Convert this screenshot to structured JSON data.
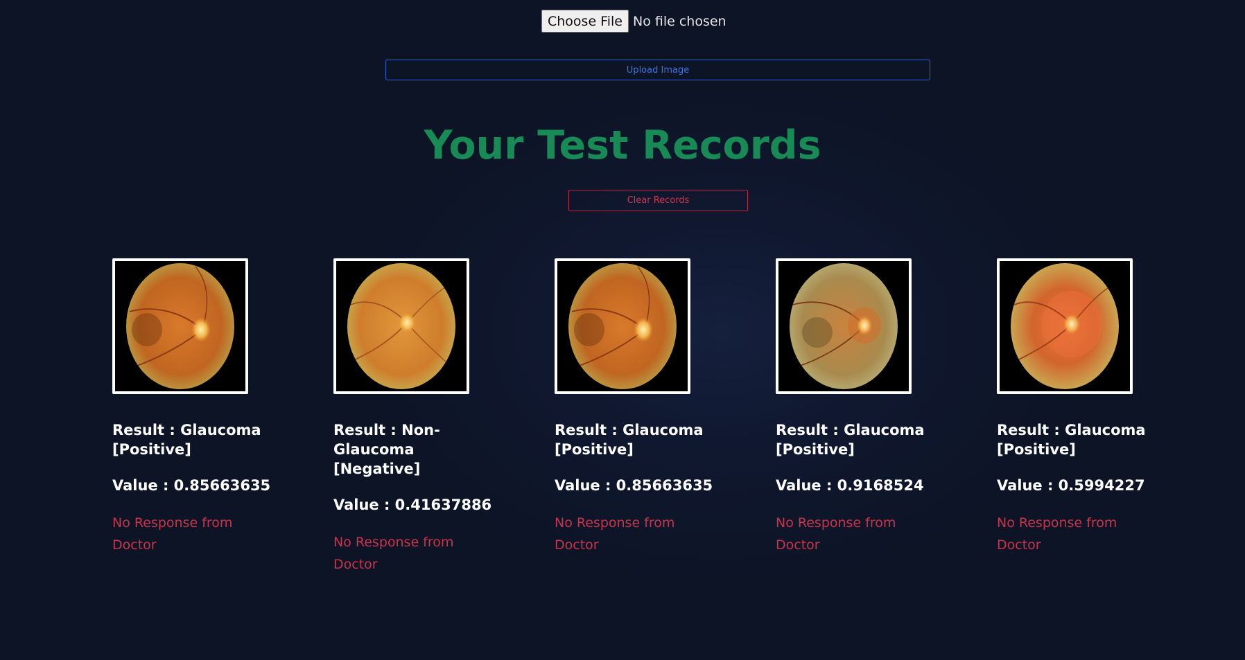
{
  "file_input": {
    "button_label": "Choose File",
    "status_text": "No file chosen"
  },
  "upload_button": {
    "label": "Upload Image"
  },
  "page_title": "Your Test Records",
  "clear_button": {
    "label": "Clear Records"
  },
  "colors": {
    "background": "#0d1426",
    "title_green": "#178a55",
    "upload_blue": "#2e63d6",
    "clear_red": "#c0283d",
    "response_red": "#c8354a"
  },
  "records": [
    {
      "result": "Result : Glaucoma [Positive]",
      "value": "Value : 0.85663635",
      "response": "No Response from Doctor",
      "image_icon": "retina-fundus-image"
    },
    {
      "result": "Result : Non-Glaucoma [Negative]",
      "value": "Value : 0.41637886",
      "response": "No Response from Doctor",
      "image_icon": "retina-fundus-image"
    },
    {
      "result": "Result : Glaucoma [Positive]",
      "value": "Value : 0.85663635",
      "response": "No Response from Doctor",
      "image_icon": "retina-fundus-image"
    },
    {
      "result": "Result : Glaucoma [Positive]",
      "value": "Value : 0.9168524",
      "response": "No Response from Doctor",
      "image_icon": "retina-fundus-image"
    },
    {
      "result": "Result : Glaucoma [Positive]",
      "value": "Value : 0.5994227",
      "response": "No Response from Doctor",
      "image_icon": "retina-fundus-image"
    }
  ]
}
